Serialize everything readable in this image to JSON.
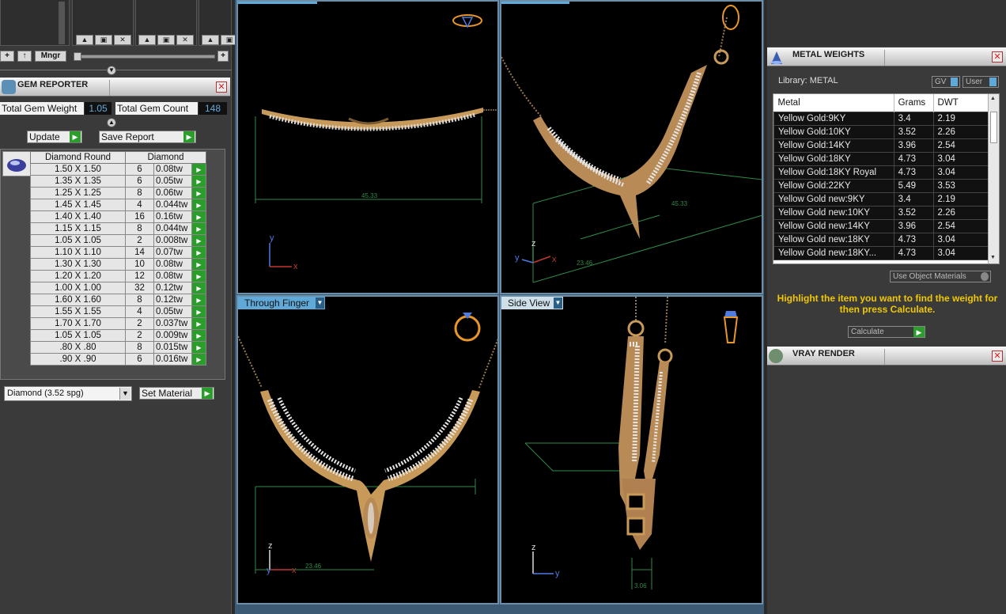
{
  "left": {
    "mngr_label": "Mngr",
    "gem_reporter": {
      "title": "GEM REPORTER",
      "total_weight_label": "Total Gem Weight",
      "total_weight_value": "1.05",
      "total_count_label": "Total Gem Count",
      "total_count_value": "148",
      "update_label": "Update",
      "save_report_label": "Save Report",
      "col_shape": "Diamond Round",
      "col_material": "Diamond",
      "rows": [
        {
          "size": "1.50 X 1.50",
          "qty": "6",
          "wt": "0.08tw"
        },
        {
          "size": "1.35 X 1.35",
          "qty": "6",
          "wt": "0.05tw"
        },
        {
          "size": "1.25 X 1.25",
          "qty": "8",
          "wt": "0.06tw"
        },
        {
          "size": "1.45 X 1.45",
          "qty": "4",
          "wt": "0.044tw"
        },
        {
          "size": "1.40 X 1.40",
          "qty": "16",
          "wt": "0.16tw"
        },
        {
          "size": "1.15 X 1.15",
          "qty": "8",
          "wt": "0.044tw"
        },
        {
          "size": "1.05 X 1.05",
          "qty": "2",
          "wt": "0.008tw"
        },
        {
          "size": "1.10 X 1.10",
          "qty": "14",
          "wt": "0.07tw"
        },
        {
          "size": "1.30 X 1.30",
          "qty": "10",
          "wt": "0.08tw"
        },
        {
          "size": "1.20 X 1.20",
          "qty": "12",
          "wt": "0.08tw"
        },
        {
          "size": "1.00 X 1.00",
          "qty": "32",
          "wt": "0.12tw"
        },
        {
          "size": "1.60 X 1.60",
          "qty": "8",
          "wt": "0.12tw"
        },
        {
          "size": "1.55 X 1.55",
          "qty": "4",
          "wt": "0.05tw"
        },
        {
          "size": "1.70 X 1.70",
          "qty": "2",
          "wt": "0.037tw"
        },
        {
          "size": "1.05 X 1.05",
          "qty": "2",
          "wt": "0.009tw"
        },
        {
          "size": ".80 X .80",
          "qty": "8",
          "wt": "0.015tw"
        },
        {
          "size": ".90 X .90",
          "qty": "6",
          "wt": "0.016tw"
        }
      ],
      "material_select": "Diamond    (3.52 spg)",
      "set_material_label": "Set Material"
    }
  },
  "viewports": {
    "top_left": {
      "dimension": "45.33",
      "axis_a": "y",
      "axis_b": "x"
    },
    "top_right": {
      "dim_a": "23.46",
      "dim_b": "45.33",
      "axis_a": "z",
      "axis_b": "y",
      "axis_c": "x"
    },
    "bottom_left": {
      "label": "Through Finger",
      "dimension": "23.46",
      "axis_a": "z",
      "axis_b": "y",
      "axis_c": "x"
    },
    "bottom_right": {
      "label": "Side View",
      "dimension": "3.06",
      "axis_a": "z",
      "axis_b": "y"
    }
  },
  "right": {
    "metal_weights": {
      "title": "METAL WEIGHTS",
      "library_label": "Library: METAL",
      "gv_label": "GV",
      "user_label": "User",
      "col_metal": "Metal",
      "col_grams": "Grams",
      "col_dwt": "DWT",
      "rows": [
        {
          "metal": "Yellow Gold:9KY",
          "grams": "3.4",
          "dwt": "2.19"
        },
        {
          "metal": "Yellow Gold:10KY",
          "grams": "3.52",
          "dwt": "2.26"
        },
        {
          "metal": "Yellow Gold:14KY",
          "grams": "3.96",
          "dwt": "2.54"
        },
        {
          "metal": "Yellow Gold:18KY",
          "grams": "4.73",
          "dwt": "3.04"
        },
        {
          "metal": "Yellow Gold:18KY Royal",
          "grams": "4.73",
          "dwt": "3.04"
        },
        {
          "metal": "Yellow Gold:22KY",
          "grams": "5.49",
          "dwt": "3.53"
        },
        {
          "metal": "Yellow Gold new:9KY",
          "grams": "3.4",
          "dwt": "2.19"
        },
        {
          "metal": "Yellow Gold new:10KY",
          "grams": "3.52",
          "dwt": "2.26"
        },
        {
          "metal": "Yellow Gold new:14KY",
          "grams": "3.96",
          "dwt": "2.54"
        },
        {
          "metal": "Yellow Gold new:18KY",
          "grams": "4.73",
          "dwt": "3.04"
        },
        {
          "metal": "Yellow Gold new:18KY...",
          "grams": "4.73",
          "dwt": "3.04"
        }
      ],
      "use_object_materials": "Use Object Materials",
      "hint": "Highlight the item you want to find the weight for then press Calculate.",
      "calculate_label": "Calculate"
    },
    "vray": {
      "title": "VRAY RENDER"
    }
  }
}
